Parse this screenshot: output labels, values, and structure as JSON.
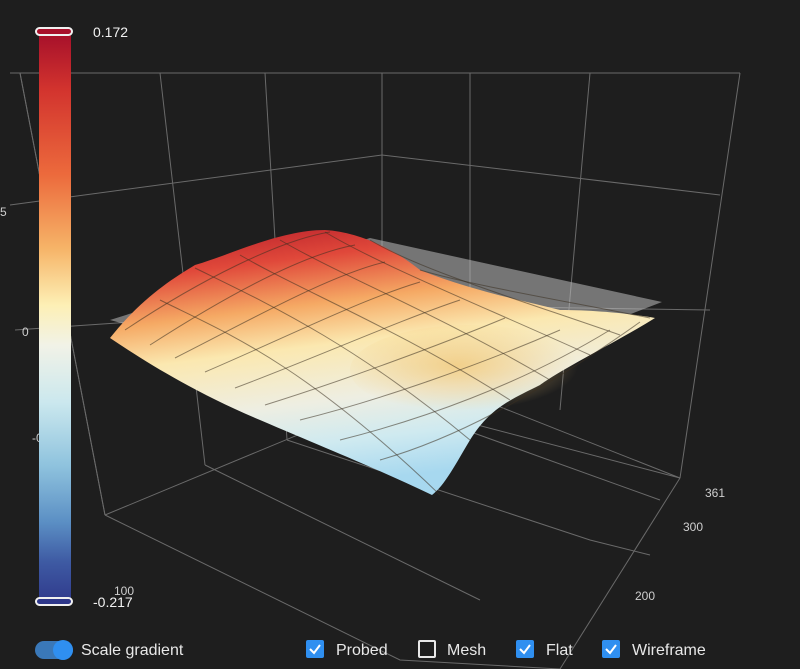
{
  "color_scale": {
    "max_label": "0.172",
    "min_label": "-0.217"
  },
  "axes": {
    "z_ticks": [
      "5",
      "0",
      "-0"
    ],
    "y_ticks": [
      "361",
      "300",
      "200"
    ],
    "x_ticks": [
      "100"
    ]
  },
  "toolbar": {
    "scale_gradient_label": "Scale gradient",
    "scale_gradient_on": true,
    "checkboxes": [
      {
        "label": "Probed",
        "checked": true
      },
      {
        "label": "Mesh",
        "checked": false
      },
      {
        "label": "Flat",
        "checked": true
      },
      {
        "label": "Wireframe",
        "checked": true
      }
    ]
  },
  "colors": {
    "background": "#1e1e1e",
    "accent": "#2f8ff0",
    "scale_max": "#a50f2a",
    "scale_min": "#303a8c"
  }
}
